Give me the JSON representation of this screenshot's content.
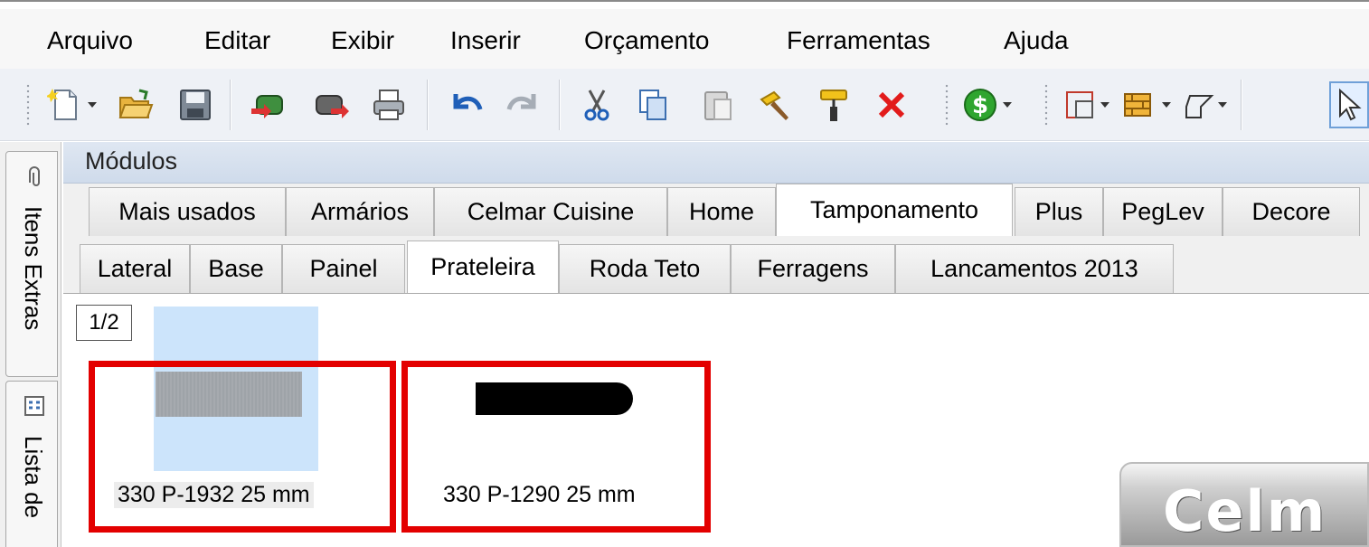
{
  "menu": [
    "Arquivo",
    "Editar",
    "Exibir",
    "Inserir",
    "Orçamento",
    "Ferramentas",
    "Ajuda"
  ],
  "toolbar": {
    "icons": [
      "new-document-icon",
      "open-folder-icon",
      "save-icon",
      "import-icon",
      "export-icon",
      "print-icon",
      "undo-icon",
      "redo-icon",
      "cut-icon",
      "copy-icon",
      "paste-icon",
      "hammer-icon",
      "paint-roller-icon",
      "delete-icon",
      "budget-dollar-icon",
      "layout-icon",
      "wall-icon",
      "shape-icon",
      "pointer-icon"
    ]
  },
  "sidebar": {
    "tab1": "Itens Extras",
    "tab2": "Lista de"
  },
  "modules": {
    "title": "Módulos",
    "category_tabs": [
      "Mais usados",
      "Armários",
      "Celmar Cuisine",
      "Home",
      "Tamponamento",
      "Plus",
      "PegLev",
      "Decore"
    ],
    "active_category": "Tamponamento",
    "sub_tabs": [
      "Lateral",
      "Base",
      "Painel",
      "Prateleira",
      "Roda Teto",
      "Ferragens",
      "Lancamentos 2013"
    ],
    "active_sub_tab": "Prateleira"
  },
  "content": {
    "page": "1/2",
    "items": [
      {
        "label": "330 P-1932 25 mm",
        "selected": true,
        "swatch": "#9ea3a8"
      },
      {
        "label": "330 P-1290 25 mm",
        "selected": false,
        "swatch": "#000000"
      }
    ]
  },
  "watermark": {
    "text": "Celm"
  },
  "colors": {
    "highlight": "#e30000",
    "selection": "#cce4fb",
    "header": "#d6e0ee"
  }
}
